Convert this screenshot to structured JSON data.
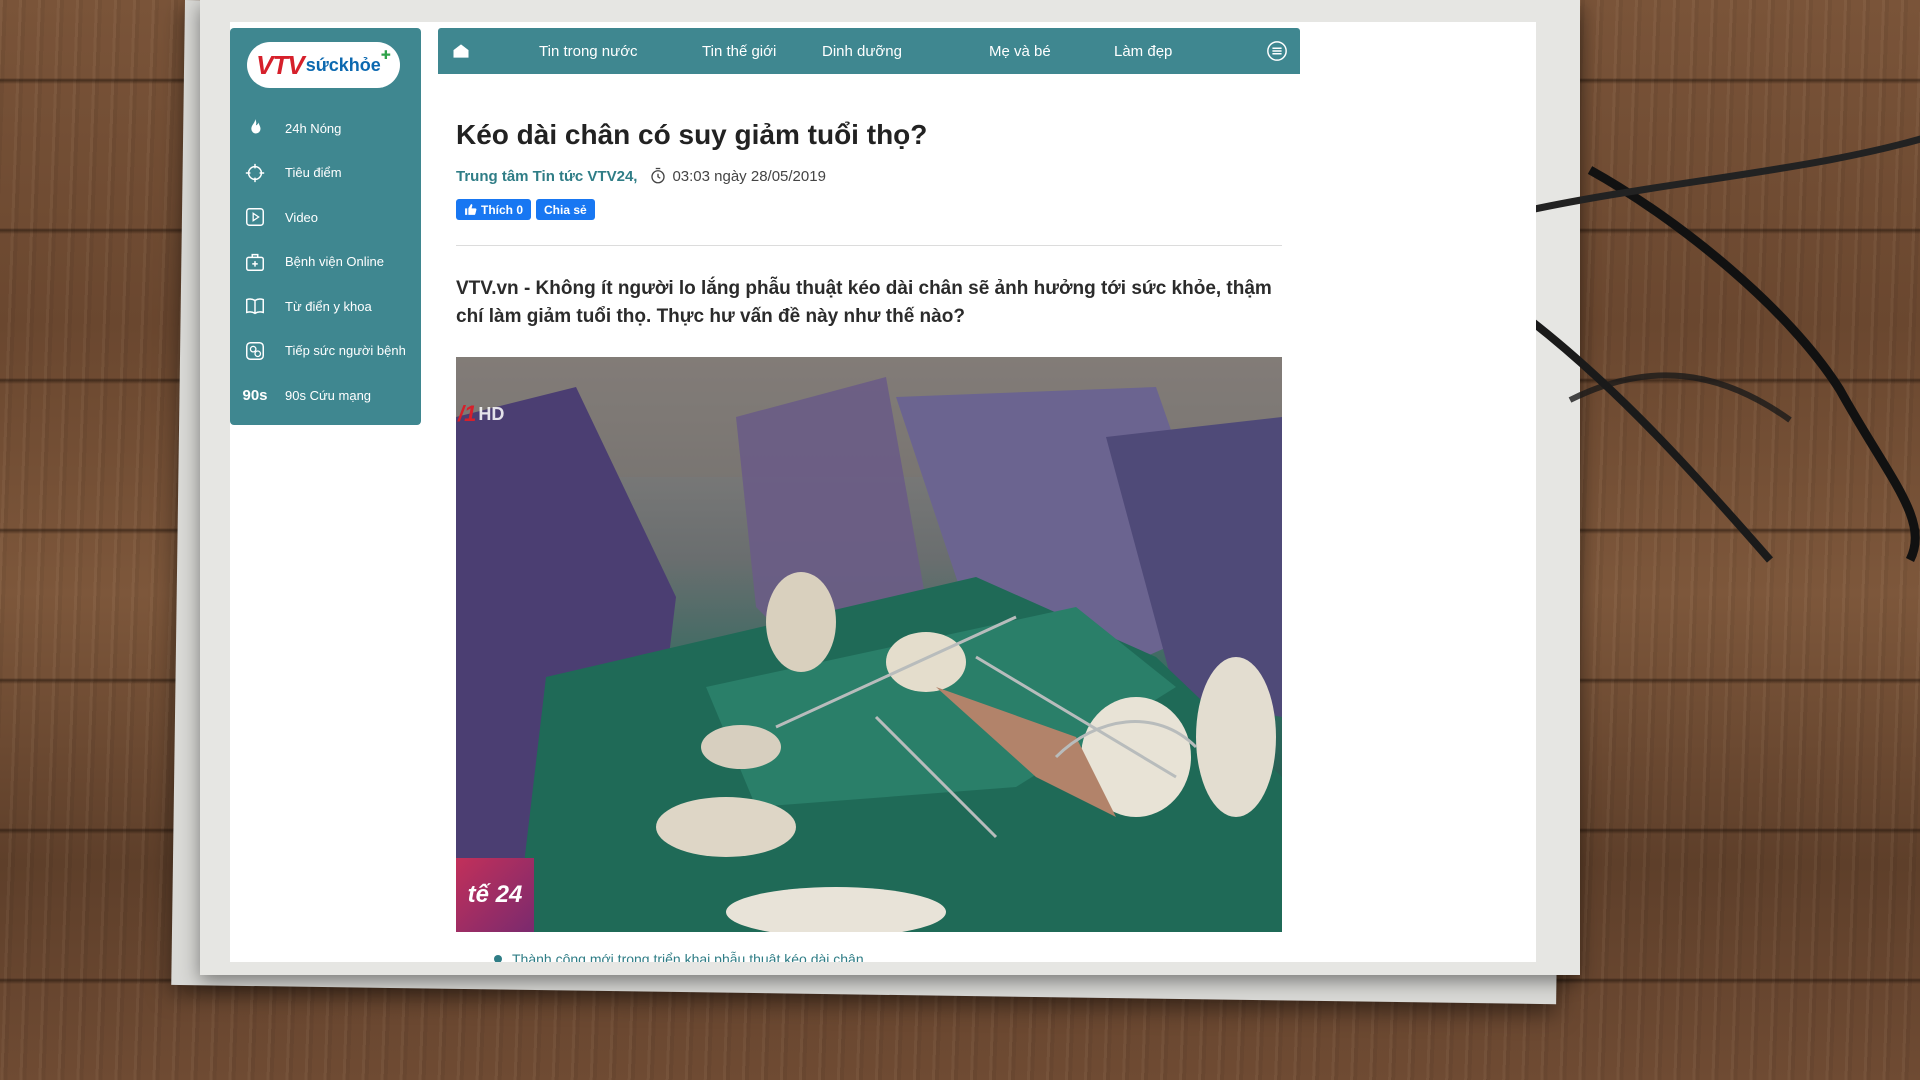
{
  "site": {
    "logo_text": "VTVsứckhỏe",
    "logo_vtv": "VTV",
    "logo_sk": "sứckhỏe",
    "brand_color": "#3f8790",
    "accent_red": "#d6202b"
  },
  "sidebar": {
    "items": [
      {
        "label": "24h Nóng",
        "icon": "flame-icon"
      },
      {
        "label": "Tiêu điểm",
        "icon": "crosshair-icon"
      },
      {
        "label": "Video",
        "icon": "video-icon"
      },
      {
        "label": "Bệnh viện Online",
        "icon": "medical-bag-icon"
      },
      {
        "label": "Từ điển y khoa",
        "icon": "book-icon"
      },
      {
        "label": "Tiếp sức người bệnh",
        "icon": "pills-icon"
      },
      {
        "label": "90s Cứu mạng",
        "icon": "ninety-seconds-icon",
        "icon_text": "90s"
      }
    ]
  },
  "topnav": {
    "items": [
      "Tin trong nước",
      "Tin thế giới",
      "Dinh dưỡng",
      "Mẹ và bé",
      "Làm đẹp"
    ]
  },
  "article": {
    "title": "Kéo dài chân có suy giảm tuổi thọ?",
    "author": "Trung tâm Tin tức VTV24,",
    "datetime": "03:03 ngày 28/05/2019",
    "like_label": "Thích 0",
    "share_label": "Chia sẻ",
    "sapo": "VTV.vn - Không ít người lo lắng phẫu thuật kéo dài chân sẽ ảnh hưởng tới sức khỏe, thậm chí làm giảm tuổi thọ. Thực hư vấn đề này như thế nào?",
    "video_watermark": "HD",
    "video_badge": "tế 24",
    "related_link": "Thành công mới trong triển khai phẫu thuật kéo dài chân"
  }
}
